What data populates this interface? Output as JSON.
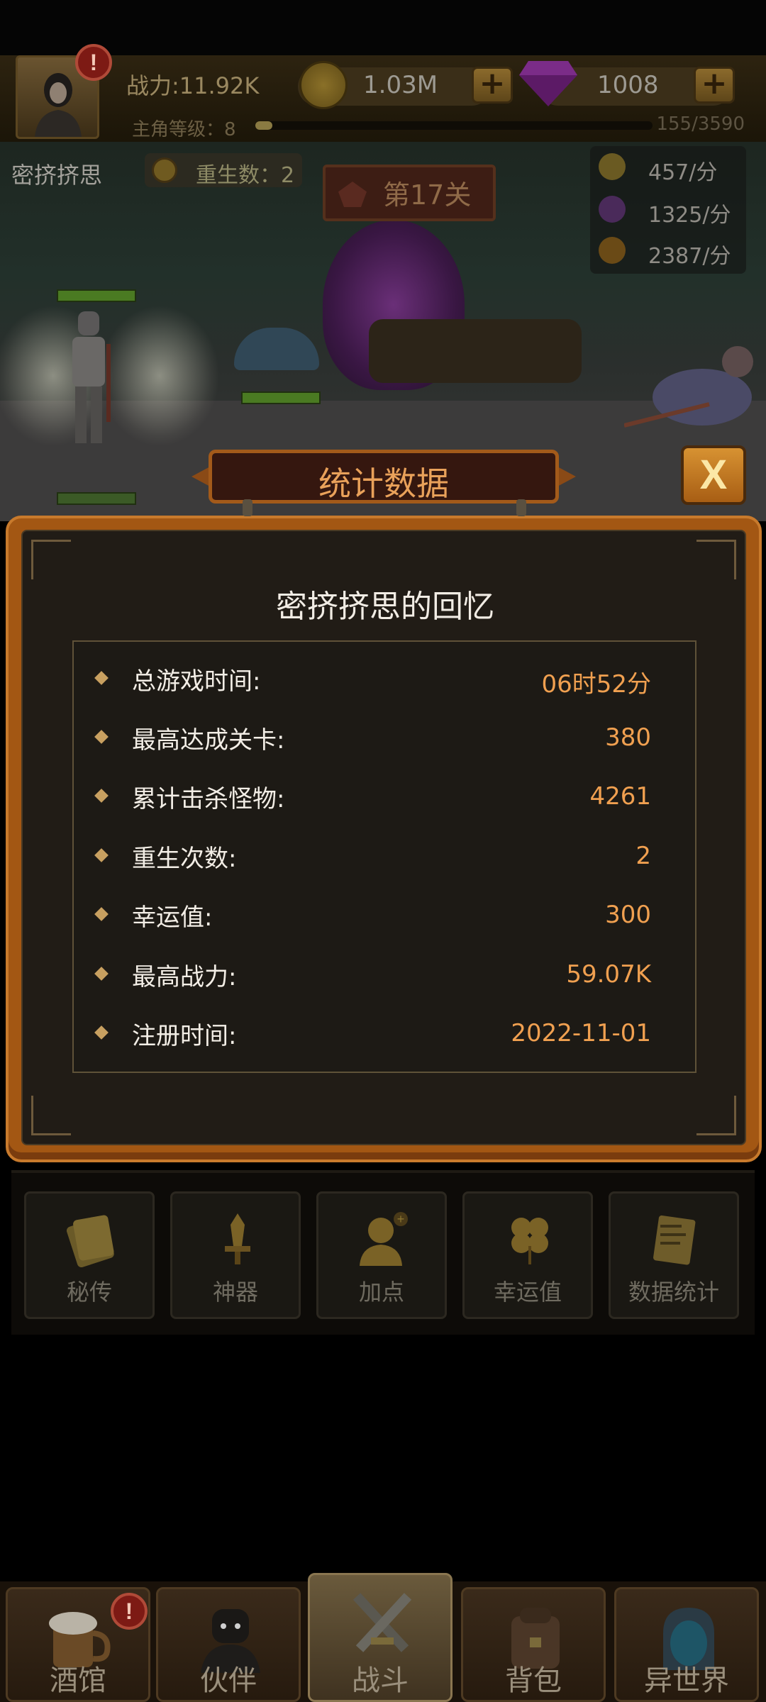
{
  "player": {
    "power": "战力:11.92K",
    "level_label": "主角等级：8",
    "xp_text": "155/3590",
    "xp_fraction": 0.043
  },
  "currency": {
    "coins": "1.03M",
    "gems": "1008"
  },
  "scene": {
    "player_name": "密挤挤思",
    "rebirth": "重生数：2",
    "stage": "第17关",
    "rates": [
      "457/分",
      "1325/分",
      "2387/分"
    ]
  },
  "modal": {
    "header": "统计数据",
    "title": "密挤挤思的回忆",
    "close_glyph": "X",
    "stats": [
      {
        "label": "总游戏时间:",
        "value": "06时52分"
      },
      {
        "label": "最高达成关卡:",
        "value": "380"
      },
      {
        "label": "累计击杀怪物:",
        "value": "4261"
      },
      {
        "label": "重生次数:",
        "value": "2"
      },
      {
        "label": "幸运值:",
        "value": "300"
      },
      {
        "label": "最高战力:",
        "value": "59.07K"
      },
      {
        "label": "注册时间:",
        "value": "2022-11-01"
      }
    ]
  },
  "functions": [
    {
      "label": "秘传",
      "icon": "scroll-book-icon"
    },
    {
      "label": "神器",
      "icon": "sword-artifact-icon"
    },
    {
      "label": "加点",
      "icon": "add-point-person-icon"
    },
    {
      "label": "幸运值",
      "icon": "clover-icon"
    },
    {
      "label": "数据统计",
      "icon": "statistics-paper-icon"
    }
  ],
  "nav": [
    {
      "label": "酒馆",
      "icon": "beer-mug-icon"
    },
    {
      "label": "伙伴",
      "icon": "companion-icon"
    },
    {
      "label": "战斗",
      "icon": "crossed-swords-icon"
    },
    {
      "label": "背包",
      "icon": "backpack-chest-icon"
    },
    {
      "label": "异世界",
      "icon": "portal-icon"
    }
  ],
  "colors": {
    "modal_frame": "#a35713",
    "stat_value": "#f0a050",
    "header_text": "#e9a15a"
  }
}
